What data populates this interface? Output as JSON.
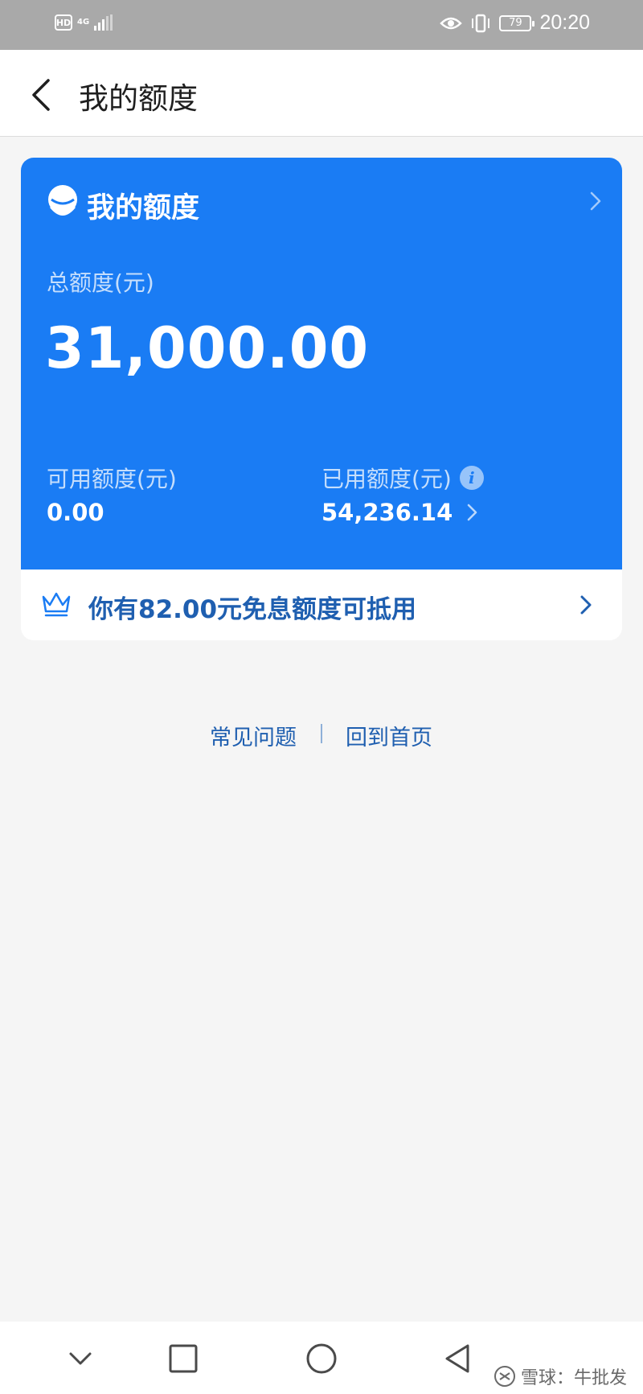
{
  "status_bar": {
    "hd": "HD",
    "network": "4G",
    "battery": "79",
    "time": "20:20"
  },
  "header": {
    "title": "我的额度"
  },
  "card": {
    "title": "我的额度",
    "total_label": "总额度(元)",
    "total_amount": "31,000.00",
    "available_label": "可用额度(元)",
    "available_value": "0.00",
    "used_label": "已用额度(元)",
    "used_value": "54,236.14",
    "info_glyph": "i",
    "promo_text": "你有82.00元免息额度可抵用"
  },
  "links": {
    "faq": "常见问题",
    "home": "回到首页"
  },
  "watermark": {
    "text": "雪球：牛批发"
  },
  "colors": {
    "accent": "#1a7cf4",
    "link": "#1f5fb0",
    "background": "#f5f5f5",
    "status_bar": "#a9a9a9"
  },
  "icons": {
    "back": "chevron-left-icon",
    "card_logo": "credit-logo-icon",
    "promo": "crown-icon",
    "nav": [
      "chevron-down-icon",
      "square-icon",
      "circle-icon",
      "triangle-back-icon"
    ]
  }
}
